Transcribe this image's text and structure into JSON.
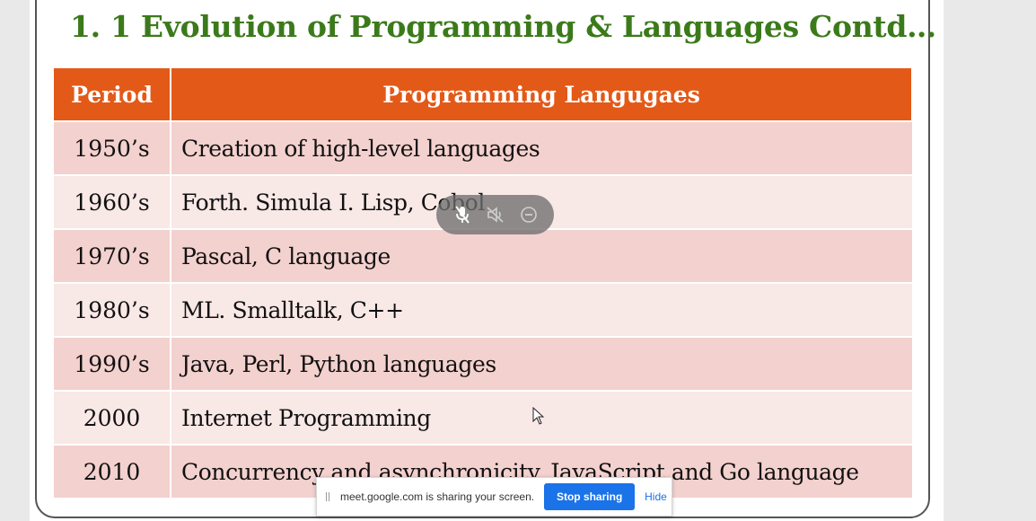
{
  "slide": {
    "title": "1. 1 Evolution of Programming & Languages Contd…",
    "table": {
      "headers": [
        "Period",
        "Programming Langugaes"
      ],
      "rows": [
        {
          "period": "1950’s",
          "languages": "Creation of high-level languages"
        },
        {
          "period": "1960’s",
          "languages": "Forth. Simula I. Lisp, Cobol"
        },
        {
          "period": "1970’s",
          "languages": "Pascal, C language"
        },
        {
          "period": "1980’s",
          "languages": "ML. Smalltalk, C++"
        },
        {
          "period": "1990’s",
          "languages": "Java, Perl, Python languages"
        },
        {
          "period": "2000",
          "languages": "Internet Programming"
        },
        {
          "period": "2010",
          "languages": "Concurrency and asynchronicity. JavaScript and Go language"
        }
      ]
    }
  },
  "media_controls": {
    "icons": [
      "mic-off-icon",
      "speaker-off-icon",
      "minus-circle-icon"
    ]
  },
  "share_bar": {
    "message": "meet.google.com is sharing your screen.",
    "stop_label": "Stop sharing",
    "hide_label": "Hide"
  },
  "colors": {
    "title": "#3b7a1a",
    "header_bg": "#e35918",
    "row_odd": "#f3d1ce",
    "row_even": "#f8e8e6",
    "accent": "#1a73e8"
  }
}
